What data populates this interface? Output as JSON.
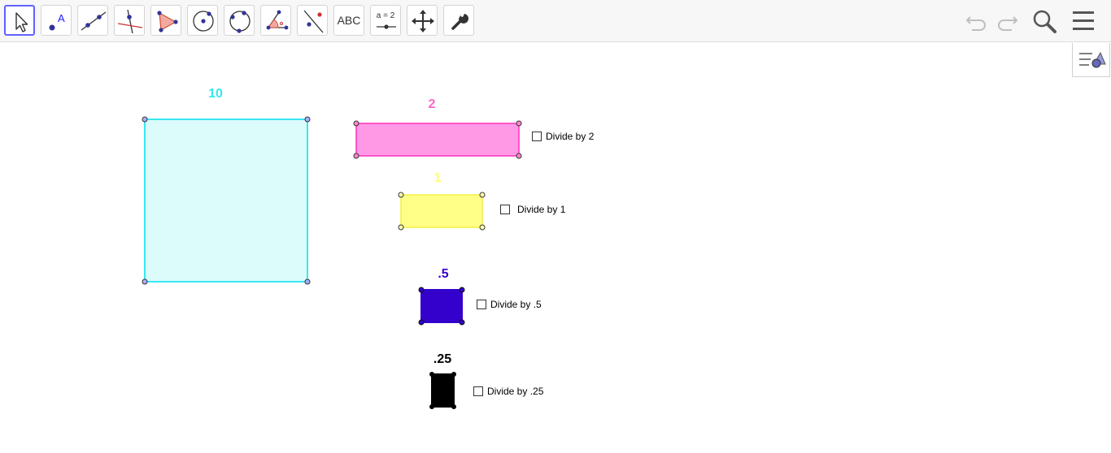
{
  "toolbar": {
    "tools": [
      {
        "name": "move-tool",
        "icon": "arrow-pointer-icon",
        "selected": true
      },
      {
        "name": "point-tool",
        "icon": "point-icon"
      },
      {
        "name": "line-tool",
        "icon": "line-icon"
      },
      {
        "name": "perpendicular-line-tool",
        "icon": "perpendicular-line-icon"
      },
      {
        "name": "polygon-tool",
        "icon": "polygon-icon"
      },
      {
        "name": "circle-center-point-tool",
        "icon": "circle-center-icon"
      },
      {
        "name": "circle-three-points-tool",
        "icon": "circle-three-points-icon"
      },
      {
        "name": "angle-tool",
        "icon": "angle-icon"
      },
      {
        "name": "reflect-about-line-tool",
        "icon": "reflect-line-icon"
      },
      {
        "name": "text-tool",
        "icon": "text-icon",
        "label": "ABC"
      },
      {
        "name": "slider-tool",
        "icon": "slider-icon",
        "label": "a = 2"
      },
      {
        "name": "move-graphics-view-tool",
        "icon": "move-arrows-icon"
      },
      {
        "name": "tools-settings-tool",
        "icon": "wrench-icon"
      }
    ],
    "right": {
      "undo": "undo-icon",
      "redo": "redo-icon",
      "search": "search-icon",
      "menu": "hamburger-menu-icon"
    },
    "accent": "#6161ff"
  },
  "stylebar_toggle": {
    "icon": "graphics-style-bar-icon"
  },
  "canvas": {
    "shapes": [
      {
        "id": "square-10",
        "label": "10",
        "fill": "#dcfcfc",
        "stroke": "#35e8f0",
        "label_color": "#35e8f0"
      },
      {
        "id": "rect-2",
        "label": "2",
        "fill": "#ff99e5",
        "stroke": "#ff33bb",
        "label_color": "#ff66cc"
      },
      {
        "id": "rect-1",
        "label": "1",
        "fill": "#ffff88",
        "stroke": "#f0f040",
        "label_color": "#ffff66"
      },
      {
        "id": "rect-05",
        "label": ".5",
        "fill": "#3300cc",
        "stroke": "#3300cc",
        "label_color": "#3300cc"
      },
      {
        "id": "rect-025",
        "label": ".25",
        "fill": "#000000",
        "stroke": "#000000",
        "label_color": "#000000"
      }
    ],
    "checkboxes": [
      {
        "label": "Divide by 2",
        "checked": false
      },
      {
        "label": "Divide by 1",
        "checked": false
      },
      {
        "label": "Divide by .5",
        "checked": false
      },
      {
        "label": "Divide by .25",
        "checked": false
      }
    ]
  }
}
